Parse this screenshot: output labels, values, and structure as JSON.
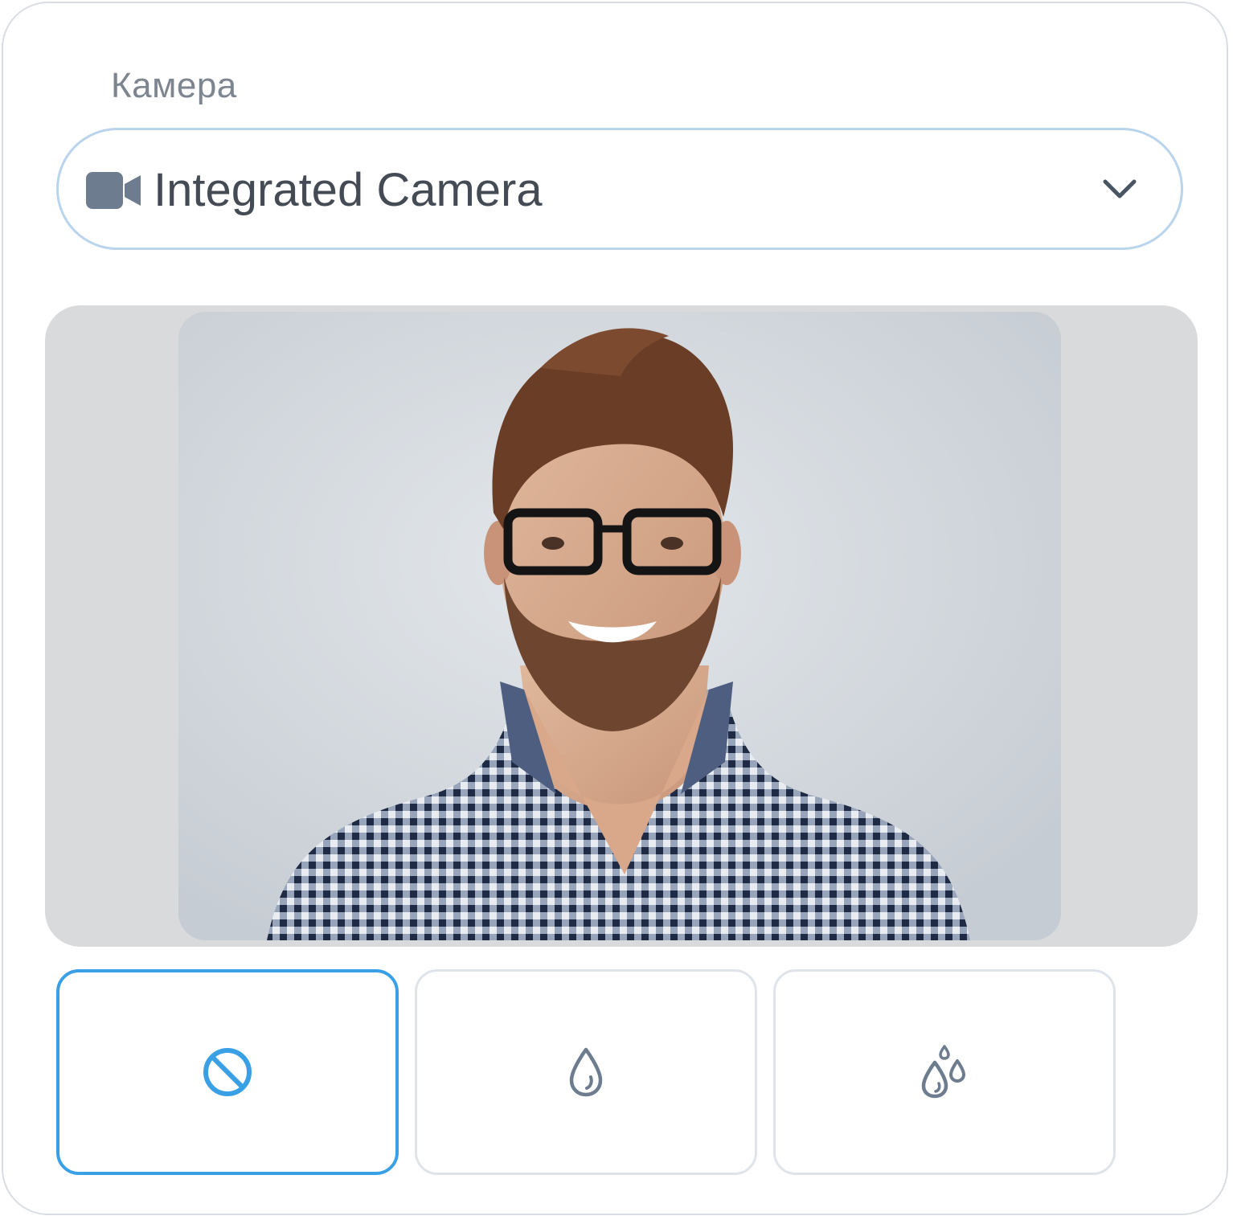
{
  "camera": {
    "label": "Камера",
    "selected_device": "Integrated Camera",
    "device_icon": "video-camera-icon",
    "dropdown_icon": "chevron-down-icon"
  },
  "preview": {
    "description_icon": "camera-preview"
  },
  "effects": [
    {
      "name": "none",
      "icon": "no-effect-icon",
      "selected": true
    },
    {
      "name": "blur-light",
      "icon": "drop-icon",
      "selected": false
    },
    {
      "name": "blur-strong",
      "icon": "drops-icon",
      "selected": false
    }
  ],
  "colors": {
    "accent": "#3aa0e6",
    "select_border": "#b9d4ec",
    "icon_gray": "#6d7c8e",
    "label_gray": "#7d8590",
    "text_dark": "#454b54"
  }
}
